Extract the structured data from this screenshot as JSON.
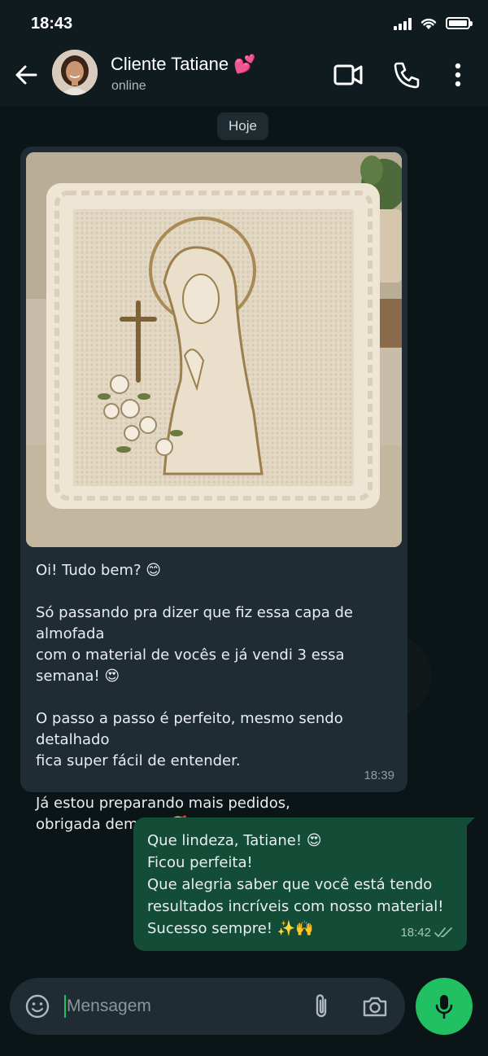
{
  "status_bar": {
    "time": "18:43"
  },
  "header": {
    "contact_name": "Cliente Tatiane 💕",
    "contact_status": "online"
  },
  "chat": {
    "date_chip": "Hoje",
    "incoming": {
      "text": "Oi! Tudo bem? 😊\n\nSó passando pra dizer que fiz essa capa de almofada\ncom o material de vocês e já vendi 3 essa semana! 😍\n\nO passo a passo é perfeito, mesmo sendo detalhado\nfica super fácil de entender.\n\nJá estou preparando mais pedidos,\nobrigada demais! 🥰",
      "time": "18:39"
    },
    "outgoing": {
      "text": "Que lindeza, Tatiane! 😍\nFicou perfeita!\nQue alegria saber que você está tendo\nresultados incríveis com nosso material!\nSucesso sempre! ✨🙌",
      "time": "18:42"
    }
  },
  "composer": {
    "placeholder": "Mensagem"
  },
  "colors": {
    "accent": "#21c063",
    "incoming_bubble": "#1f2c33",
    "outgoing_bubble": "#144d37",
    "header_bg": "#101b1f"
  },
  "icons": [
    "back-arrow-icon",
    "video-call-icon",
    "phone-icon",
    "more-options-icon",
    "emoji-icon",
    "attach-icon",
    "camera-icon",
    "mic-icon",
    "double-check-icon"
  ]
}
